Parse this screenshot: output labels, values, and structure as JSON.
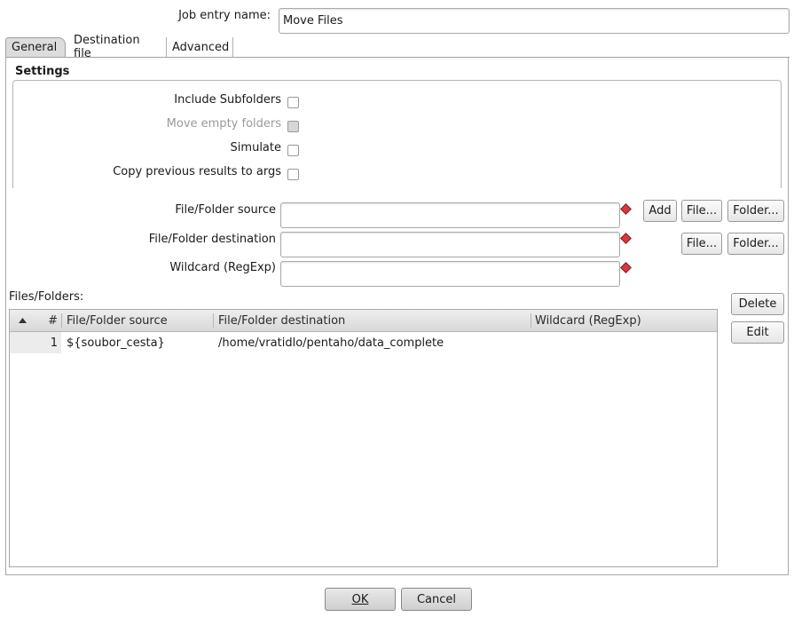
{
  "job_entry": {
    "label": "Job entry name:",
    "value": "Move Files"
  },
  "tabs": [
    {
      "label": "General"
    },
    {
      "label": "Destination file"
    },
    {
      "label": "Advanced"
    }
  ],
  "settings": {
    "title": "Settings",
    "include_subfolders": "Include Subfolders",
    "move_empty_folders": "Move empty folders",
    "simulate": "Simulate",
    "copy_previous": "Copy previous results to args"
  },
  "fields": {
    "source_label": "File/Folder source",
    "destination_label": "File/Folder destination",
    "wildcard_label": "Wildcard (RegExp)"
  },
  "buttons": {
    "add": "Add",
    "file": "File...",
    "folder": "Folder...",
    "delete": "Delete",
    "edit": "Edit",
    "ok": "OK",
    "cancel": "Cancel"
  },
  "files_folders": {
    "label": "Files/Folders:",
    "columns": [
      "#",
      "File/Folder source",
      "File/Folder destination",
      "Wildcard (RegExp)"
    ],
    "rows": [
      {
        "num": "1",
        "source": "${soubor_cesta}",
        "destination": "/home/vratidlo/pentaho/data_complete",
        "wildcard": ""
      }
    ]
  },
  "colors": {
    "accent_warning": "#d9363e",
    "panel_border": "#a9a9a9"
  },
  "icons": {
    "required_marker": "required-diamond-icon",
    "sort": "sort-up-icon"
  }
}
